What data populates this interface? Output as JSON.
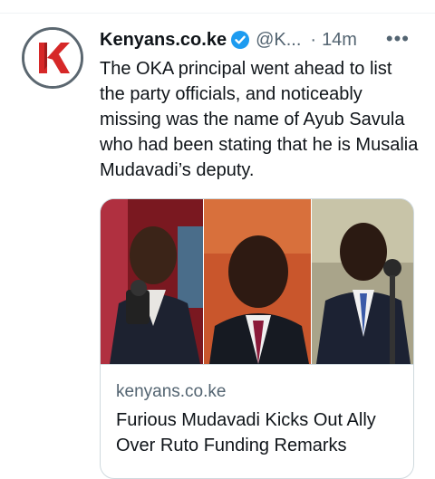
{
  "tweet": {
    "author": "Kenyans.co.ke",
    "handle": "@K...",
    "separator": "·",
    "time": "14m",
    "more": "•••",
    "text": "The OKA principal went ahead to list the party officials, and noticeably missing was the name of Ayub Savula who had been stating that he is Musalia Mudavadi’s deputy.",
    "verified_icon": "verified-badge-icon",
    "colors": {
      "verified": "#1d9bf0",
      "logo_red": "#d62828",
      "muted": "#536471"
    }
  },
  "card": {
    "domain": "kenyans.co.ke",
    "title": "Furious Mudavadi Kicks Out Ally Over Ruto Funding Remarks"
  }
}
